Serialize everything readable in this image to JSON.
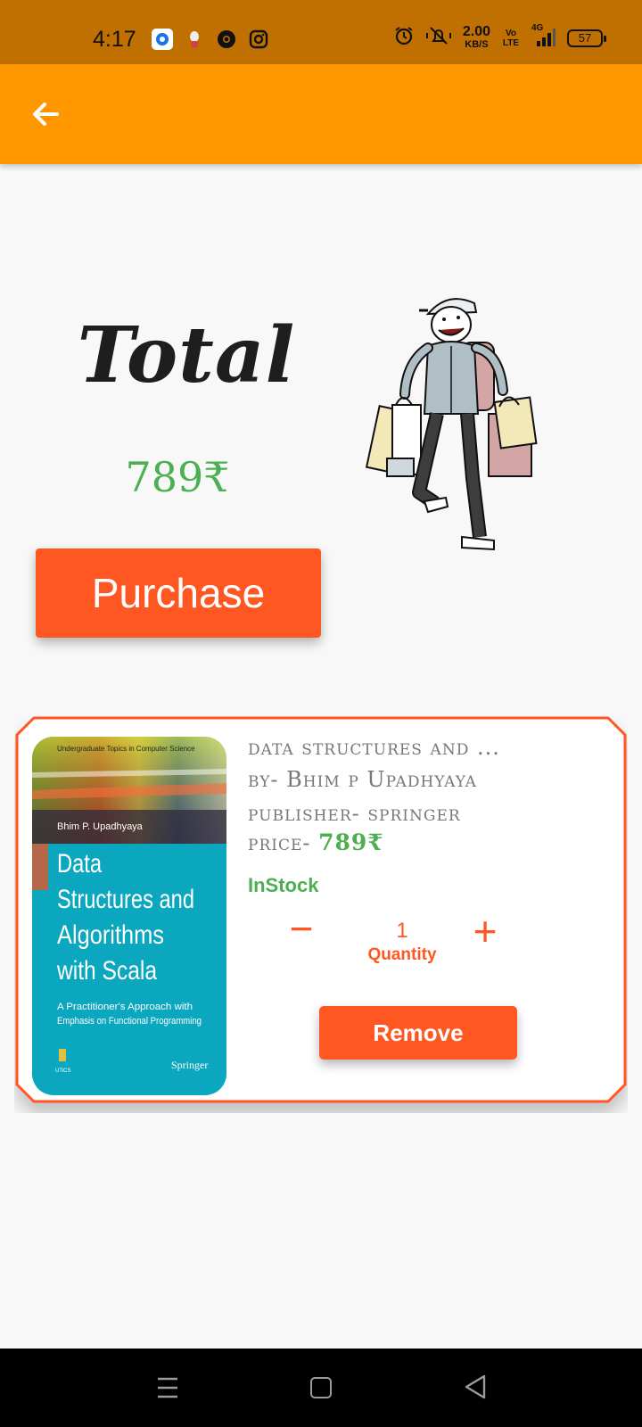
{
  "status_bar": {
    "time": "4:17",
    "net_speed_value": "2.00",
    "net_speed_unit": "KB/S",
    "volte": "Vo LTE",
    "network": "4G",
    "battery": "57"
  },
  "app_bar": {
    "back_icon": "arrow-back-icon"
  },
  "summary": {
    "title": "Total",
    "amount": "789₹",
    "purchase_label": "Purchase"
  },
  "cart": {
    "items": [
      {
        "title": "data structures and ...",
        "author": "by- Bhim p Upadhyaya",
        "publisher": "publisher- springer",
        "price_label": "price-",
        "price": "789₹",
        "stock": "InStock",
        "quantity": "1",
        "quantity_label": "Quantity",
        "minus": "−",
        "plus": "+",
        "remove_label": "Remove",
        "cover": {
          "series": "Undergraduate Topics in Computer Science",
          "author": "Bhim P. Upadhyaya",
          "title_line1": "Data",
          "title_line2": "Structures and",
          "title_line3": "Algorithms",
          "title_line4": "with Scala",
          "subtitle_line1": "A Practitioner's Approach with",
          "subtitle_line2": "Emphasis on Functional Programming",
          "series_abbr": "UTiCS",
          "publisher": "Springer"
        }
      }
    ]
  },
  "colors": {
    "status_bar": "#bf7000",
    "app_bar": "#ff9800",
    "accent": "#ff5722",
    "success": "#4caf50"
  }
}
